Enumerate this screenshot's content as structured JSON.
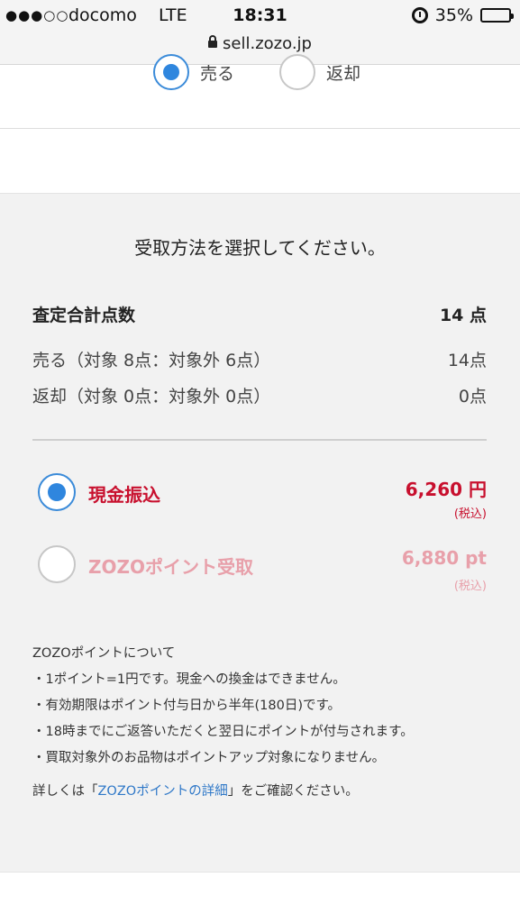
{
  "status_bar": {
    "signal": "●●●○○",
    "carrier": "docomo",
    "network": "LTE",
    "time": "18:31",
    "battery": "35%",
    "battery_level": 0.35,
    "url": "sell.zozo.jp"
  },
  "top_options": [
    {
      "label": "売る",
      "selected": true
    },
    {
      "label": "返却",
      "selected": false
    }
  ],
  "panel": {
    "title": "受取方法を選択してください。",
    "total": {
      "label": "査定合計点数",
      "value": "14 点"
    },
    "sell": {
      "label": "売る（対象 8点：対象外 6点）",
      "value": "14点"
    },
    "return": {
      "label": "返却（対象 0点：対象外 0点）",
      "value": "0点"
    },
    "payment_options": [
      {
        "name": "現金振込",
        "amount": "6,260 円",
        "tax": "(税込)",
        "selected": true
      },
      {
        "name": "ZOZOポイント受取",
        "amount": "6,880 pt",
        "tax": "(税込)",
        "selected": false
      }
    ],
    "notes": {
      "heading": "ZOZOポイントについて",
      "items": [
        "・1ポイント=1円です。現金への換金はできません。",
        "・有効期限はポイント付与日から半年(180日)です。",
        "・18時までにご返答いただくと翌日にポイントが付与されます。",
        "・買取対象外のお品物はポイントアップ対象になりません。"
      ],
      "more_prefix": "詳しくは「",
      "more_link": "ZOZOポイントの詳細",
      "more_suffix": "」をご確認ください。"
    }
  },
  "colors": {
    "accent": "#2f86de",
    "price_red": "#c8102e",
    "price_pink": "#e8a0aa",
    "link": "#2f78c8"
  }
}
